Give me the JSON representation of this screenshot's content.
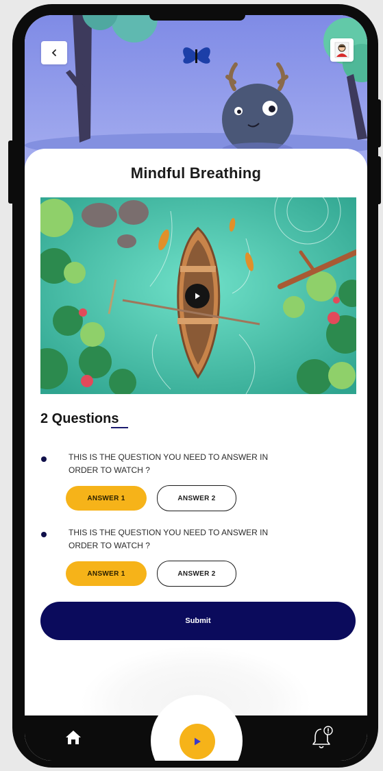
{
  "screen": {
    "title": "Mindful Breathing",
    "back_icon": "chevron-left-icon",
    "avatar_icon": "user-avatar-icon"
  },
  "video": {
    "play_icon": "play-icon"
  },
  "questions": {
    "count_label": "2 Questions",
    "items": [
      {
        "text": "THIS IS THE QUESTION YOU NEED TO ANSWER IN ORDER TO WATCH ?",
        "answers": [
          {
            "label": "ANSWER 1",
            "selected": true
          },
          {
            "label": "ANSWER 2",
            "selected": false
          }
        ]
      },
      {
        "text": "THIS IS THE QUESTION YOU NEED TO ANSWER IN ORDER TO WATCH ?",
        "answers": [
          {
            "label": "ANSWER 1",
            "selected": true
          },
          {
            "label": "ANSWER 2",
            "selected": false
          }
        ]
      }
    ]
  },
  "submit_label": "Submit",
  "nav": {
    "home_icon": "home-icon",
    "play_icon": "play-icon",
    "notification_icon": "bell-alert-icon"
  },
  "colors": {
    "accent": "#f6b319",
    "primary": "#0b0b5c",
    "sky": "#8f9ae8",
    "water": "#4fc9b5"
  }
}
